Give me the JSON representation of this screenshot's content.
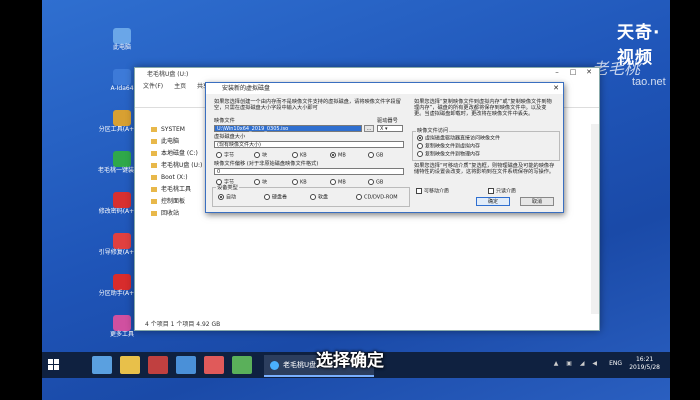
{
  "watermark": {
    "logo": "天奇·视频",
    "brand": "老毛桃",
    "url": "tao.net"
  },
  "desktop_icons": [
    {
      "label": "此电脑",
      "color": "#6aa6e8"
    },
    {
      "label": "A-Ida64",
      "color": "#3d7ad8"
    },
    {
      "label": "分区工具(A+RD)",
      "color": "#d8a032"
    },
    {
      "label": "老毛桃一键装机(A+RD)",
      "color": "#2fa84a"
    },
    {
      "label": "修改密码(A+RD)",
      "color": "#d83030"
    },
    {
      "label": "引导修复(A+RD)",
      "color": "#e04040"
    },
    {
      "label": "分区助手(A+RD)",
      "color": "#d82c2c"
    },
    {
      "label": "更多工具",
      "color": "#d050a0"
    }
  ],
  "explorer": {
    "title": "老毛桃U盘 (U:)",
    "menu": [
      "文件(F)",
      "主页",
      "共享",
      "查看"
    ],
    "sidebar": [
      "SYSTEM",
      "此电脑",
      "本地磁盘 (C:)",
      "老毛桃U盘 (U:)",
      "Boot (X:)",
      "老毛桃工具",
      "控制面板",
      "回收站"
    ],
    "status": "4 个项目  1 个项目  4.92 GB"
  },
  "dialog": {
    "title": "安装新的虚拟磁盘",
    "desc_left": "如果您选择创建一个由内存而不是映像文件支持的虚拟磁盘，请将映像文件字段留空，只需在虚拟磁盘大小字段中输入大小即可",
    "image_file_label": "映像文件",
    "image_file_value": "U:\\Win10x64_2019_0305.iso",
    "drive_label": "驱动器号",
    "drive_value": "X",
    "disk_size_label": "虚拟磁盘大小",
    "disk_size_value": "(现有映像文件大小)",
    "size_units": [
      "字节",
      "块",
      "KB",
      "MB",
      "GB"
    ],
    "size_unit_selected": 3,
    "offset_label": "映像文件偏移 (对于非原始磁盘映像文件格式)",
    "offset_value": "0",
    "offset_units": [
      "字节",
      "块",
      "KB",
      "MB",
      "GB"
    ],
    "device_type_label": "设备类型",
    "device_types": [
      "自动",
      "硬盘卷",
      "软盘",
      "CD/DVD-ROM"
    ],
    "device_type_selected": 0,
    "desc_right": "如果您选择“复制映像文件到虚拟内存”或“复制映像文件到物理内存”，磁盘的所有更改都将保存到映像文件中。以及变更。当虚拟磁盘卸载时，更改将在映像文件中丢失。",
    "access_label": "映像文件访问",
    "access_options": [
      "虚拟磁盘驱动器直接访问映像文件",
      "复制映像文件到虚拟内存",
      "复制映像文件到物理内存"
    ],
    "access_selected": 0,
    "desc_right2": "如果您选择“可移动介质”复选框，则物理磁盘及可能的映像存储特性的设置会改变，这将影响到在文件系统保存的写操作。",
    "removable_label": "可移动介质",
    "readonly_label": "只读介质",
    "ok_label": "确定",
    "cancel_label": "取消"
  },
  "taskbar": {
    "active_window": "老毛桃U盘 (U:)",
    "lang": "ENG",
    "time": "16:21",
    "date": "2019/5/28",
    "apps": [
      "#5aa0e0",
      "#e8c04a",
      "#c04040",
      "#4a90d8",
      "#e05a5a",
      "#5ab05a"
    ]
  },
  "caption": "选择确定"
}
